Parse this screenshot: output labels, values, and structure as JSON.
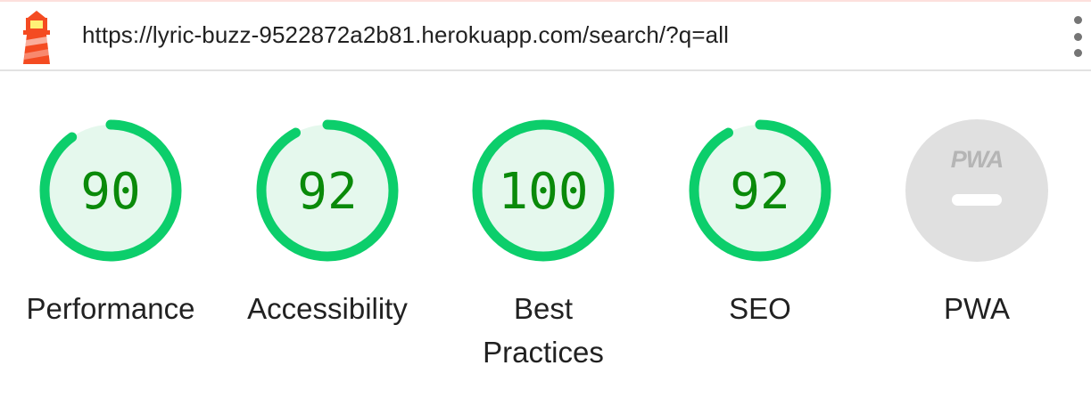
{
  "topbar": {
    "logo_icon": "lighthouse-icon",
    "url": "https://lyric-buzz-9522872a2b81.herokuapp.com/search/?q=all",
    "menu_icon": "kebab-menu-icon"
  },
  "colors": {
    "pass": "#0cce6b",
    "pass_fill": "#e5f8ed",
    "pass_text": "#0a8a0a",
    "pwa_fill": "#e0e0e0",
    "pwa_text": "#b5b5b5"
  },
  "gauges": [
    {
      "id": "performance",
      "score": "90",
      "value": 90,
      "label": "Performance"
    },
    {
      "id": "accessibility",
      "score": "92",
      "value": 92,
      "label": "Accessibility"
    },
    {
      "id": "best-practices",
      "score": "100",
      "value": 100,
      "label": "Best Practices"
    },
    {
      "id": "seo",
      "score": "92",
      "value": 92,
      "label": "SEO"
    }
  ],
  "pwa": {
    "badge": "PWA",
    "label": "PWA",
    "icon": "pwa-badge-icon"
  }
}
